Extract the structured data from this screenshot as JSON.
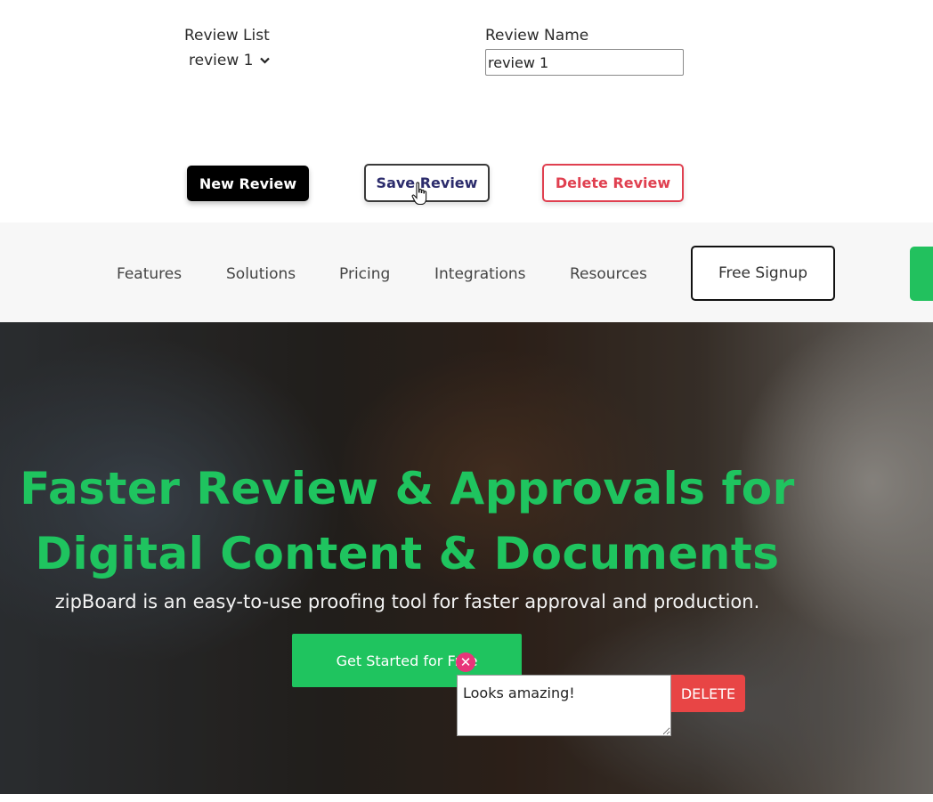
{
  "review_panel": {
    "list_label": "Review List",
    "selected_review": "review 1",
    "name_label": "Review Name",
    "name_value": "review 1",
    "new_button": "New Review",
    "save_button": "Save Review",
    "delete_button": "Delete Review"
  },
  "nav": {
    "items": [
      "Features",
      "Solutions",
      "Pricing",
      "Integrations",
      "Resources"
    ],
    "signup": "Free Signup"
  },
  "hero": {
    "title_line1": "Faster Review & Approvals for",
    "title_line2": "Digital Content & Documents",
    "subtitle": "zipBoard is an easy-to-use proofing tool for faster approval and production.",
    "cta": "Get Started for Free"
  },
  "comment": {
    "text": "Looks amazing!",
    "delete_label": "DELETE",
    "close_glyph": "✕"
  },
  "colors": {
    "brand_green": "#1fc45f",
    "delete_red": "#e04050",
    "comment_close_pink": "#e8357a"
  },
  "icons": {
    "dropdown": "chevron-down-icon",
    "cursor": "hand-pointer-icon",
    "comment_close": "close-icon"
  }
}
